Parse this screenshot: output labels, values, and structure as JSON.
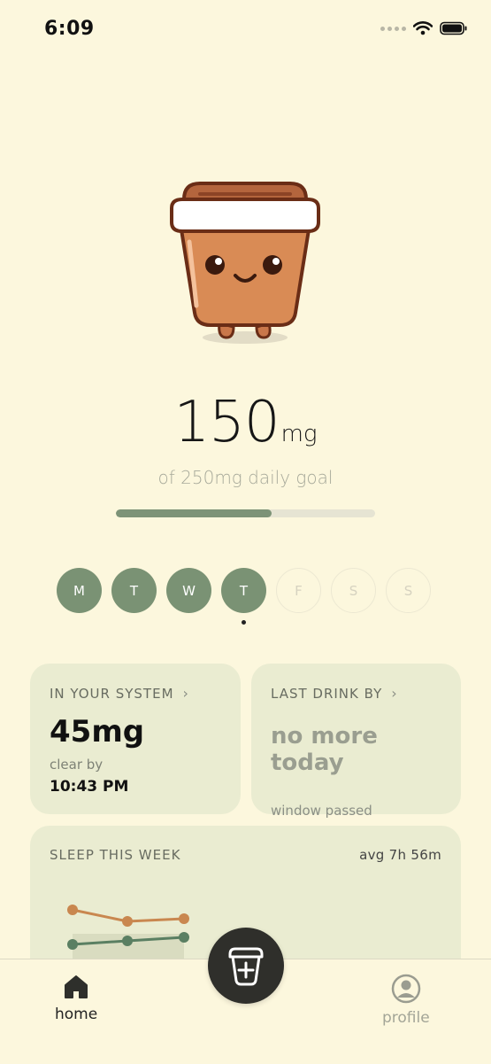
{
  "status_bar": {
    "time": "6:09"
  },
  "intake": {
    "amount": "150",
    "unit": "mg",
    "goal_text": "of 250mg daily goal",
    "progress_fraction": 0.6
  },
  "week": {
    "days": [
      {
        "label": "M",
        "done": true
      },
      {
        "label": "T",
        "done": true
      },
      {
        "label": "W",
        "done": true
      },
      {
        "label": "T",
        "done": true,
        "today": true
      },
      {
        "label": "F",
        "done": false
      },
      {
        "label": "S",
        "done": false
      },
      {
        "label": "S",
        "done": false
      }
    ]
  },
  "cards": {
    "system": {
      "title": "IN YOUR SYSTEM",
      "value": "45mg",
      "clear_label": "clear by",
      "clear_time": "10:43 PM"
    },
    "last_drink": {
      "title": "LAST DRINK BY",
      "value": "no more today",
      "sub": "window passed"
    },
    "sleep": {
      "title": "SLEEP THIS WEEK",
      "avg": "avg 7h 56m"
    }
  },
  "tab_bar": {
    "home_label": "home",
    "profile_label": "profile"
  },
  "colors": {
    "background": "#fcf7dd",
    "accent_green": "#7a9274",
    "card": "#eaecd1",
    "coffee_brown": "#d4874d",
    "fab": "#2f2f2b"
  },
  "icons": {
    "mascot": "coffee-cup-mascot",
    "fab": "add-cup-icon",
    "home": "home-icon",
    "profile": "profile-icon"
  }
}
